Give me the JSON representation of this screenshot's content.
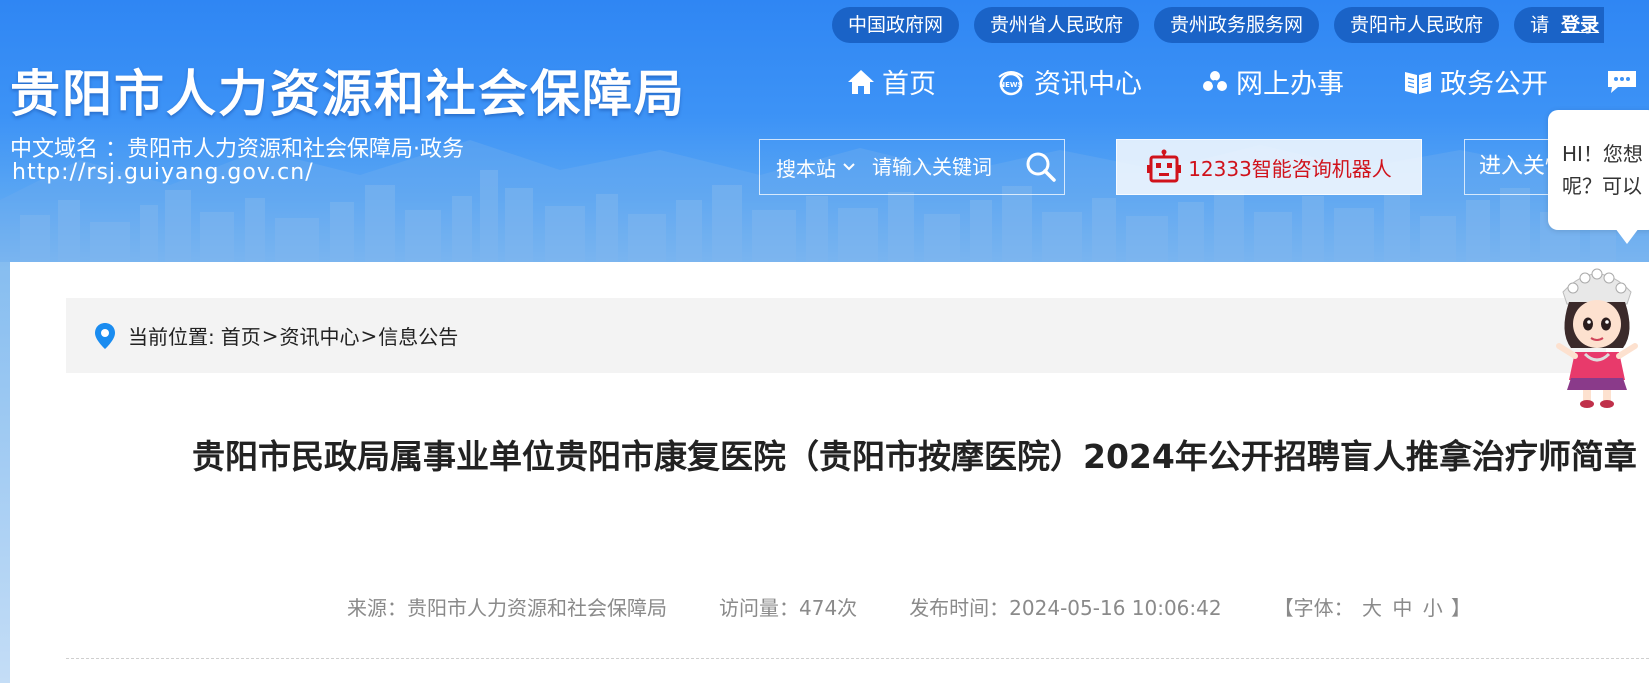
{
  "header": {
    "top_links": [
      "中国政府网",
      "贵州省人民政府",
      "贵州政务服务网",
      "贵阳市人民政府"
    ],
    "login_prefix": "请",
    "login_label": "登录",
    "site_title": "贵阳市人力资源和社会保障局",
    "domain_line": "中文域名 ：贵阳市人力资源和社会保障局·政务",
    "url_line": "http://rsj.guiyang.gov.cn/",
    "nav": [
      "首页",
      "资讯中心",
      "网上办事",
      "政务公开"
    ],
    "search_scope": "搜本站",
    "search_placeholder": "请输入关键词",
    "robot_label": "12333智能咨询机器人",
    "enter_label": "进入关怀版",
    "colors": {
      "header": "#2f86f3",
      "pill": "#1a63c7",
      "robot_text": "#d0121b"
    }
  },
  "breadcrumb": {
    "prefix": "当前位置:",
    "items": [
      "首页",
      "资讯中心",
      "信息公告"
    ],
    "separator": ">"
  },
  "article": {
    "title": "贵阳市民政局属事业单位贵阳市康复医院（贵阳市按摩医院）2024年公开招聘盲人推拿治疗师简章",
    "source": "来源：贵阳市人力资源和社会保障局",
    "views": "访问量：474次",
    "published": "发布时间：2024-05-16 10:06:42",
    "font_label_open": "【字体：",
    "font_sizes": [
      "大",
      "中",
      "小"
    ],
    "font_label_close": "】"
  },
  "assistant": {
    "bubble_line1": "HI！您想",
    "bubble_line2": "呢？可以"
  }
}
